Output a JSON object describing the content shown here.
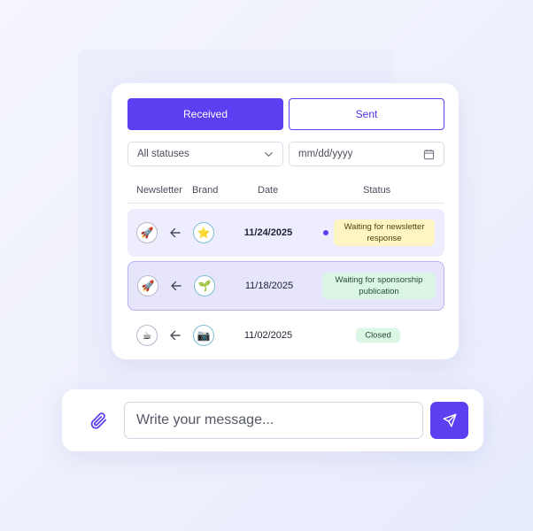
{
  "tabs": {
    "received": "Received",
    "sent": "Sent"
  },
  "filters": {
    "status_value": "All statuses",
    "date_placeholder": "mm/dd/yyyy"
  },
  "table": {
    "headers": {
      "newsletter": "Newsletter",
      "brand": "Brand",
      "date": "Date",
      "status": "Status"
    },
    "rows": [
      {
        "newsletter_icon": "rocket-icon",
        "newsletter_glyph": "🚀",
        "direction": "arrow-left-icon",
        "brand_icon": "star-badge-icon",
        "brand_glyph": "⭐",
        "date": "11/24/2025",
        "status": "Waiting for newsletter response",
        "status_color": "#fdf6c4",
        "unread": true
      },
      {
        "newsletter_icon": "rocket-icon",
        "newsletter_glyph": "🚀",
        "direction": "arrow-left-icon",
        "brand_icon": "sprout-icon",
        "brand_glyph": "🌱",
        "date": "11/18/2025",
        "status": "Waiting for sponsorship publication",
        "status_color": "#dcf6e6",
        "unread": false
      },
      {
        "newsletter_icon": "coffee-icon",
        "newsletter_glyph": "☕",
        "direction": "arrow-left-icon",
        "brand_icon": "camera-icon",
        "brand_glyph": "📷",
        "date": "11/02/2025",
        "status": "Closed",
        "status_color": "#dcf6e6",
        "unread": false
      }
    ]
  },
  "composer": {
    "placeholder": "Write your message..."
  },
  "colors": {
    "accent": "#5b3ff0",
    "unread_dot": "#5b3ff0"
  }
}
